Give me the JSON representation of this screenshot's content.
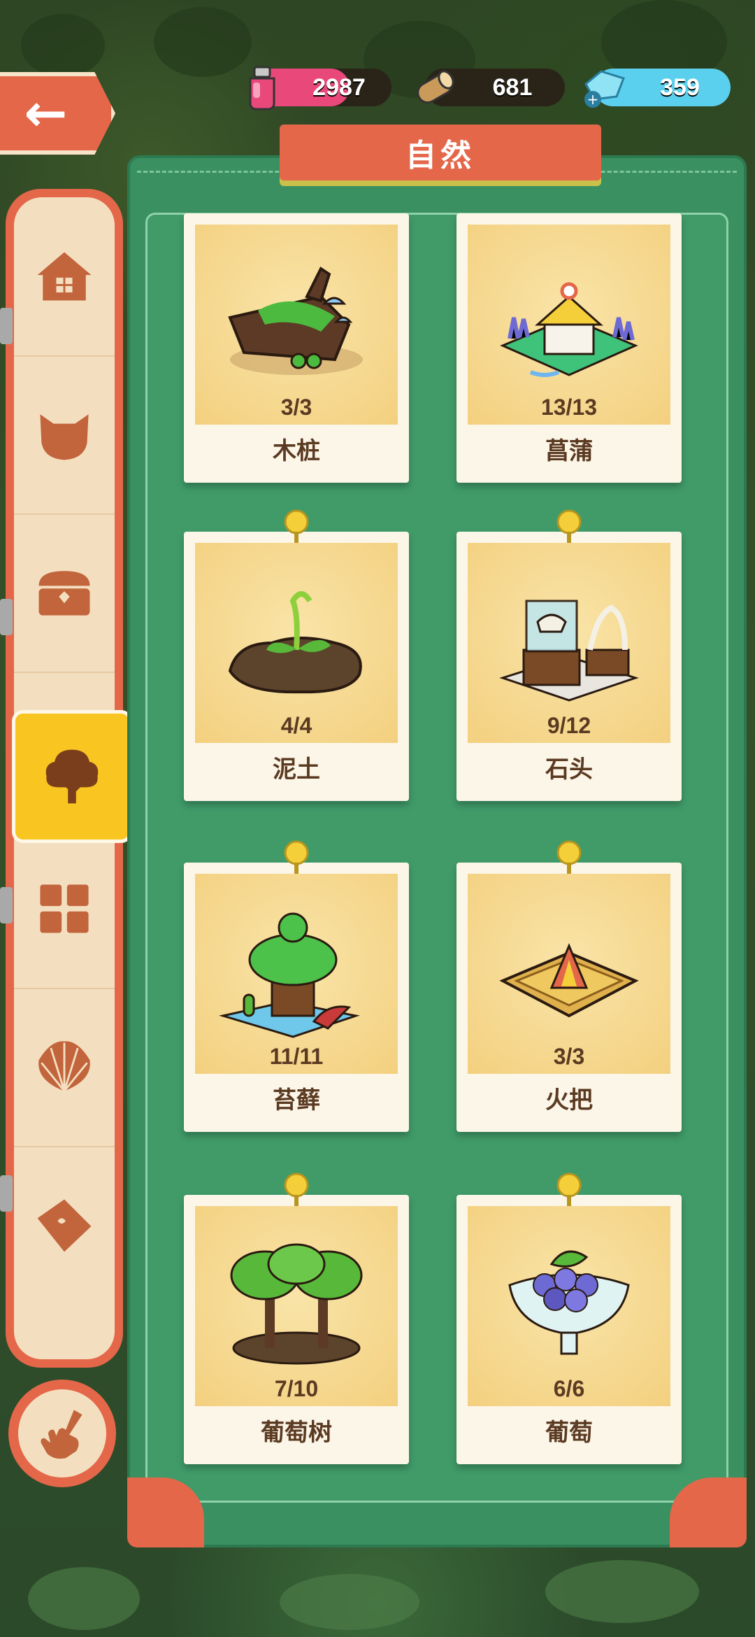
{
  "header": {
    "back_label": "back",
    "resources": [
      {
        "name": "potion",
        "value": "2987",
        "icon": "potion-icon"
      },
      {
        "name": "wood",
        "value": "681",
        "icon": "log-icon"
      },
      {
        "name": "crystal",
        "value": "359",
        "icon": "crystal-plus-icon"
      }
    ]
  },
  "panel": {
    "title": "自然"
  },
  "sidebar": {
    "tabs": [
      "house-icon",
      "cat-icon",
      "chest-icon",
      "tree-icon",
      "grid-icon",
      "shell-icon",
      "ticket-icon"
    ],
    "active_tab": "tree-icon",
    "hand_button": "hand-icon"
  },
  "cards": [
    {
      "name": "木桩",
      "count": "3/3",
      "icon": "tree-stump-icon"
    },
    {
      "name": "菖蒲",
      "count": "13/13",
      "icon": "calamus-pavilion-icon"
    },
    {
      "name": "泥土",
      "count": "4/4",
      "icon": "soil-sprout-icon"
    },
    {
      "name": "石头",
      "count": "9/12",
      "icon": "fossil-display-icon"
    },
    {
      "name": "苔藓",
      "count": "11/11",
      "icon": "moss-house-icon"
    },
    {
      "name": "火把",
      "count": "3/3",
      "icon": "campfire-icon"
    },
    {
      "name": "葡萄树",
      "count": "7/10",
      "icon": "grapevine-icon"
    },
    {
      "name": "葡萄",
      "count": "6/6",
      "icon": "grape-bowl-icon"
    }
  ],
  "colors": {
    "accent": "#e4674a",
    "panel": "#3a9061",
    "active_tab": "#f8c521",
    "card": "#f6d88e"
  }
}
